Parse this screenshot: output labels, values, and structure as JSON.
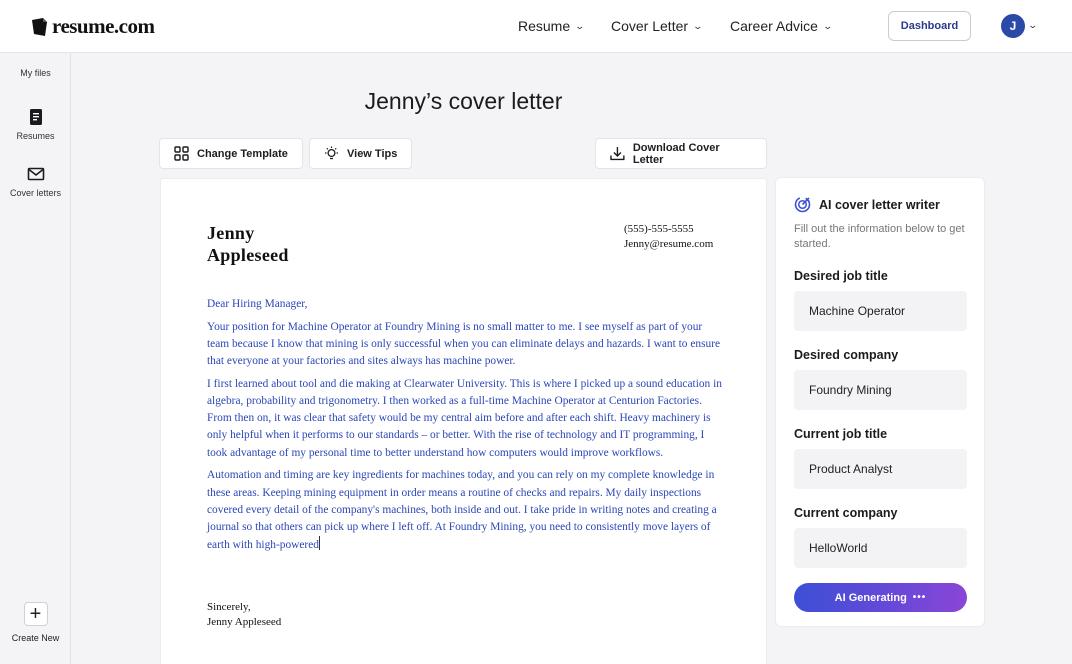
{
  "header": {
    "logo": "resume.com",
    "nav": [
      "Resume",
      "Cover Letter",
      "Career Advice"
    ],
    "dashboard_label": "Dashboard",
    "avatar_initial": "J"
  },
  "sidebar": {
    "my_files": "My files",
    "resumes": "Resumes",
    "cover_letters": "Cover letters",
    "create_new": "Create New"
  },
  "page_title": "Jenny’s cover letter",
  "toolbar": {
    "change_template": "Change Template",
    "view_tips": "View Tips",
    "download": "Download Cover Letter"
  },
  "letter": {
    "first_name": "Jenny",
    "last_name": "Appleseed",
    "phone": "(555)-555-5555",
    "email": "Jenny@resume.com",
    "greeting": "Dear Hiring Manager,",
    "paragraphs": [
      "Your position for Machine Operator at Foundry Mining is no small matter to me. I see myself as part of your team because I know that mining is only successful when you can eliminate delays and hazards. I want to ensure that everyone at your factories and sites always has machine power.",
      "I first learned about tool and die making at Clearwater University. This is where I picked up a sound education in algebra, probability and trigonometry. I then worked as a full-time Machine Operator at Centurion Factories. From then on, it was clear that safety would be my central aim before and after each shift. Heavy machinery is only helpful when it performs to our standards – or better. With the rise of technology and IT programming, I took advantage of my personal time to better understand how computers would improve workflows.",
      "Automation and timing are key ingredients for machines today, and you can rely on my complete knowledge in these areas. Keeping mining equipment in order means a routine of checks and repairs. My daily inspections covered every detail of the company's machines, both inside and out. I take pride in writing notes and creating a journal so that others can pick up where I left off. At Foundry Mining, you need to consistently move layers of earth with high-powered"
    ],
    "sign_off": "Sincerely,",
    "signature": "Jenny Appleseed"
  },
  "ai_panel": {
    "title": "AI cover letter writer",
    "subtitle": "Fill out the information below to get started.",
    "fields": [
      {
        "label": "Desired job title",
        "value": "Machine Operator"
      },
      {
        "label": "Desired company",
        "value": "Foundry Mining"
      },
      {
        "label": "Current job title",
        "value": "Product Analyst"
      },
      {
        "label": "Current company",
        "value": "HelloWorld"
      }
    ],
    "button_label": "AI Generating",
    "accent": "#3d4fd6"
  }
}
